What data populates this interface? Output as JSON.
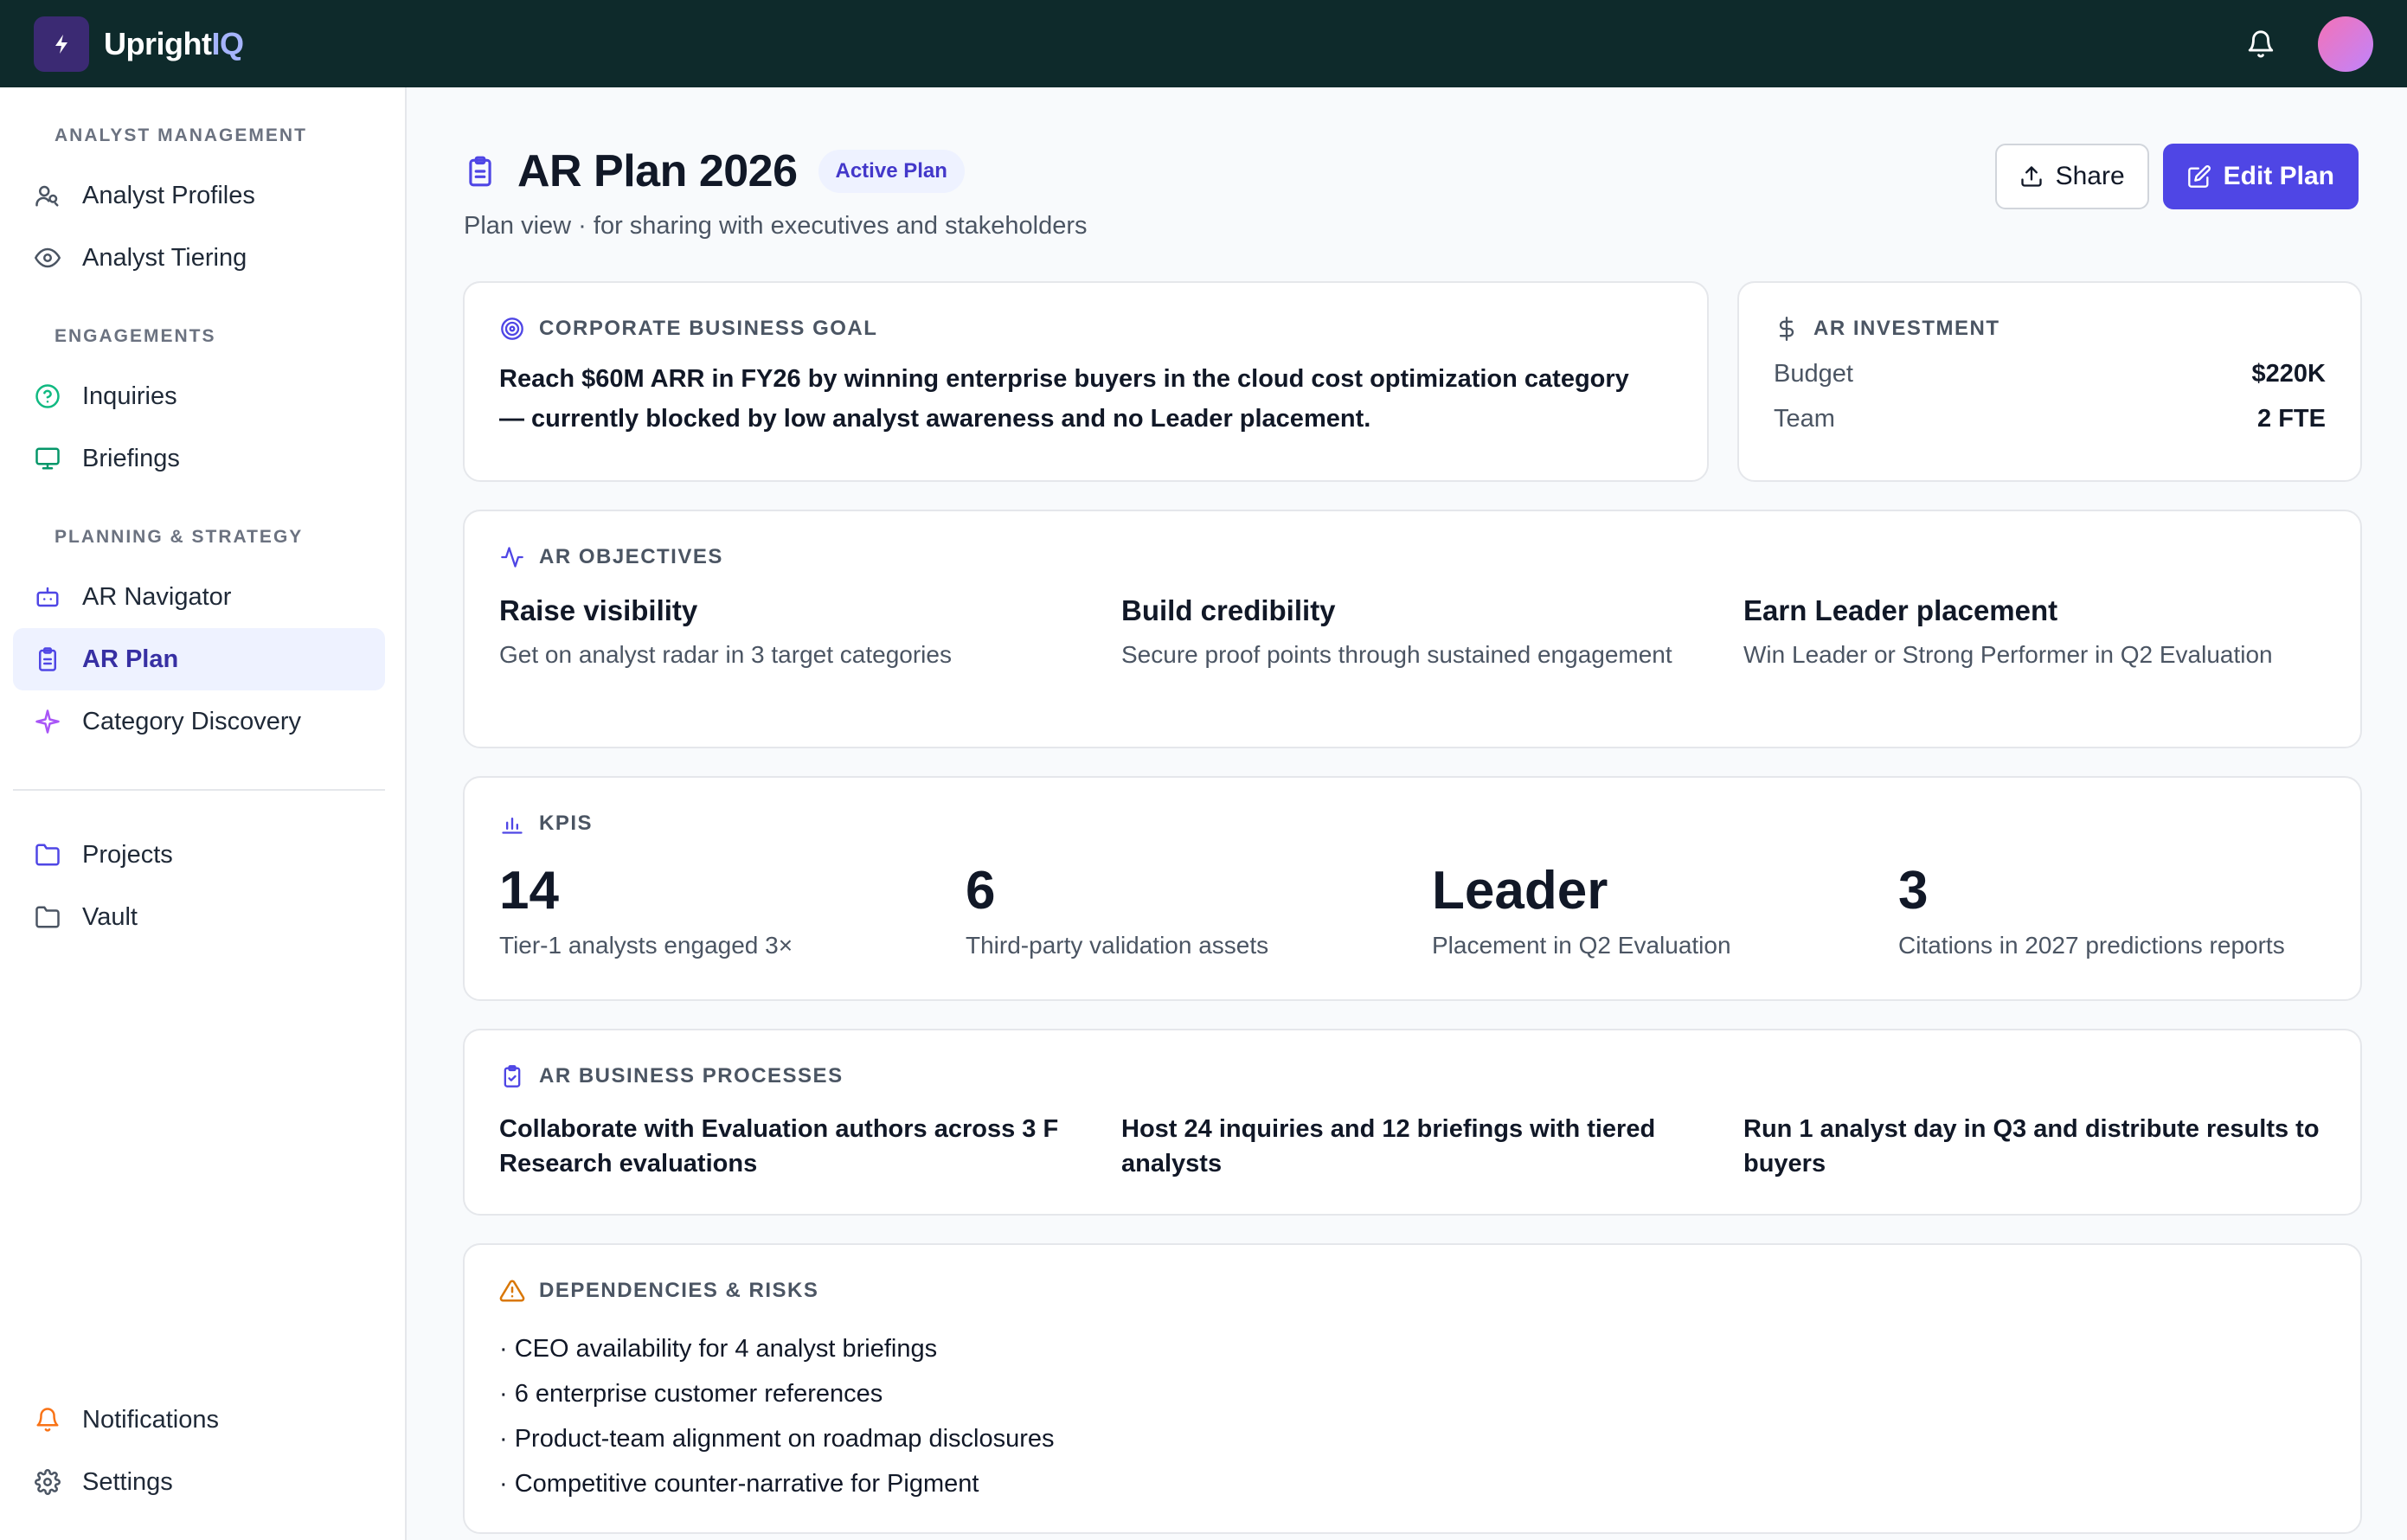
{
  "app": {
    "brand_main": "Upright",
    "brand_accent": "IQ"
  },
  "sidebar": {
    "sections": [
      {
        "title": "ANALYST MANAGEMENT",
        "items": [
          "Analyst Profiles",
          "Analyst Tiering"
        ]
      },
      {
        "title": "ENGAGEMENTS",
        "items": [
          "Inquiries",
          "Briefings"
        ]
      },
      {
        "title": "PLANNING & STRATEGY",
        "items": [
          "AR Navigator",
          "AR Plan",
          "Category Discovery"
        ]
      }
    ],
    "other_items": [
      "Projects",
      "Vault"
    ],
    "bottom_items": [
      "Notifications",
      "Settings"
    ],
    "active_item": "AR Plan"
  },
  "header": {
    "title": "AR Plan 2026",
    "badge": "Active Plan",
    "subtitle": "Plan view · for sharing with executives and stakeholders",
    "share_label": "Share",
    "edit_label": "Edit Plan"
  },
  "goal": {
    "label": "CORPORATE BUSINESS GOAL",
    "text": "Reach $60M ARR in FY26 by winning enterprise buyers in the cloud cost optimization category — currently blocked by low analyst awareness and no Leader placement."
  },
  "investment": {
    "label": "AR INVESTMENT",
    "rows": [
      {
        "key": "Budget",
        "value": "$220K"
      },
      {
        "key": "Team",
        "value": "2 FTE"
      }
    ]
  },
  "objectives": {
    "label": "AR OBJECTIVES",
    "items": [
      {
        "title": "Raise visibility",
        "desc": "Get on analyst radar in 3 target categories"
      },
      {
        "title": "Build credibility",
        "desc": "Secure proof points through sustained engagement"
      },
      {
        "title": "Earn Leader placement",
        "desc": "Win Leader or Strong Performer in Q2 Evaluation"
      }
    ]
  },
  "kpis": {
    "label": "KPIS",
    "items": [
      {
        "value": "14",
        "desc": "Tier-1 analysts engaged 3×"
      },
      {
        "value": "6",
        "desc": "Third-party validation assets"
      },
      {
        "value": "Leader",
        "desc": "Placement in Q2 Evaluation"
      },
      {
        "value": "3",
        "desc": "Citations in 2027 predictions reports"
      }
    ]
  },
  "processes": {
    "label": "AR BUSINESS PROCESSES",
    "items": [
      "Collaborate with Evaluation authors across 3 F Research evaluations",
      "Host 24 inquiries and 12 briefings with tiered analysts",
      "Run 1 analyst day in Q3 and distribute results to buyers"
    ]
  },
  "risks": {
    "label": "DEPENDENCIES & RISKS",
    "items": [
      "· CEO availability for 4 analyst briefings",
      "· 6 enterprise customer references",
      "· Product-team alignment on roadmap disclosures",
      "· Competitive counter-narrative for Pigment"
    ]
  },
  "colors": {
    "topbar": "#0e2a2b",
    "accent": "#4f46e5",
    "active_bg": "#eef2ff",
    "warning": "#d97706",
    "success": "#10b981"
  }
}
